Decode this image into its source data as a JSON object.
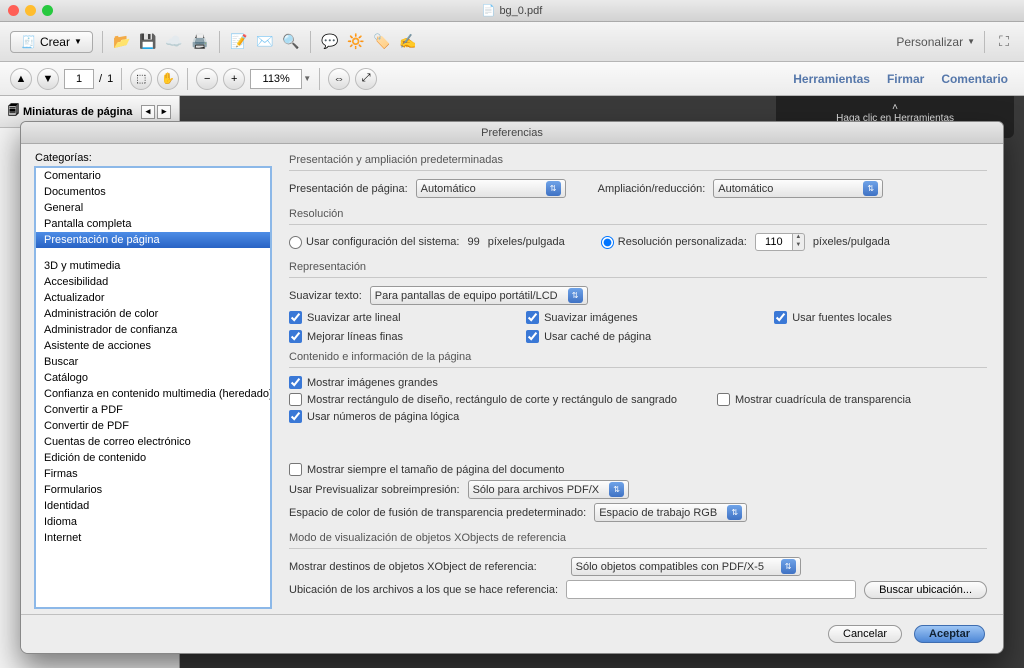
{
  "window": {
    "title": "bg_0.pdf"
  },
  "toolbar1": {
    "crear": "Crear",
    "personalizar": "Personalizar"
  },
  "toolbar2": {
    "page_current": "1",
    "page_sep": "/",
    "page_total": "1",
    "zoom": "113%",
    "herramientas": "Herramientas",
    "firmar": "Firmar",
    "comentario": "Comentario"
  },
  "thumbs": {
    "title": "Miniaturas de página"
  },
  "hint": "Haga clic en Herramientas",
  "prefs": {
    "title": "Preferencias",
    "cat_label": "Categorías:",
    "categories_top": [
      "Comentario",
      "Documentos",
      "General",
      "Pantalla completa",
      "Presentación de página"
    ],
    "categories_rest": [
      "3D y mutimedia",
      "Accesibilidad",
      "Actualizador",
      "Administración de color",
      "Administrador de confianza",
      "Asistente de acciones",
      "Buscar",
      "Catálogo",
      "Confianza en contenido multimedia (heredado)",
      "Convertir a PDF",
      "Convertir de PDF",
      "Cuentas de correo electrónico",
      "Edición de contenido",
      "Firmas",
      "Formularios",
      "Identidad",
      "Idioma",
      "Internet"
    ],
    "sect_presentacion": "Presentación y ampliación predeterminadas",
    "lbl_pres_pagina": "Presentación de página:",
    "sel_automatico": "Automático",
    "lbl_ampliacion": "Ampliación/reducción:",
    "sect_resolucion": "Resolución",
    "lbl_usar_config": "Usar configuración del sistema:",
    "system_ppi": "99",
    "ppi_unit": "píxeles/pulgada",
    "lbl_res_pers": "Resolución personalizada:",
    "custom_ppi": "110",
    "sect_repr": "Representación",
    "lbl_suavizar_texto": "Suavizar texto:",
    "sel_pantallas": "Para pantallas de equipo portátil/LCD",
    "chk_suav_arte": "Suavizar arte lineal",
    "chk_suav_img": "Suavizar imágenes",
    "chk_fuentes_loc": "Usar fuentes locales",
    "chk_mejorar_lineas": "Mejorar líneas finas",
    "chk_cache": "Usar caché de página",
    "sect_contenido": "Contenido e información de la página",
    "chk_img_grandes": "Mostrar imágenes grandes",
    "chk_rectangulo": "Mostrar rectángulo de diseño, rectángulo de corte y rectángulo de sangrado",
    "chk_cuadricula": "Mostrar cuadrícula de transparencia",
    "chk_num_logica": "Usar números de página lógica",
    "chk_tamano_doc": "Mostrar siempre el tamaño de página del documento",
    "lbl_prev_sobre": "Usar Previsualizar sobreimpresión:",
    "sel_solo_pdfx": "Sólo para archivos PDF/X",
    "lbl_espacio_color": "Espacio de color de fusión de transparencia predeterminado:",
    "sel_rgb": "Espacio de trabajo RGB",
    "sect_xobjects": "Modo de visualización de objetos XObjects de referencia",
    "lbl_mostrar_dest": "Mostrar destinos de objetos XObject de referencia:",
    "sel_solo_compat": "Sólo objetos compatibles con PDF/X-5",
    "lbl_ubicacion": "Ubicación de los archivos a los que se hace referencia:",
    "btn_buscar": "Buscar ubicación...",
    "btn_cancelar": "Cancelar",
    "btn_aceptar": "Aceptar"
  }
}
